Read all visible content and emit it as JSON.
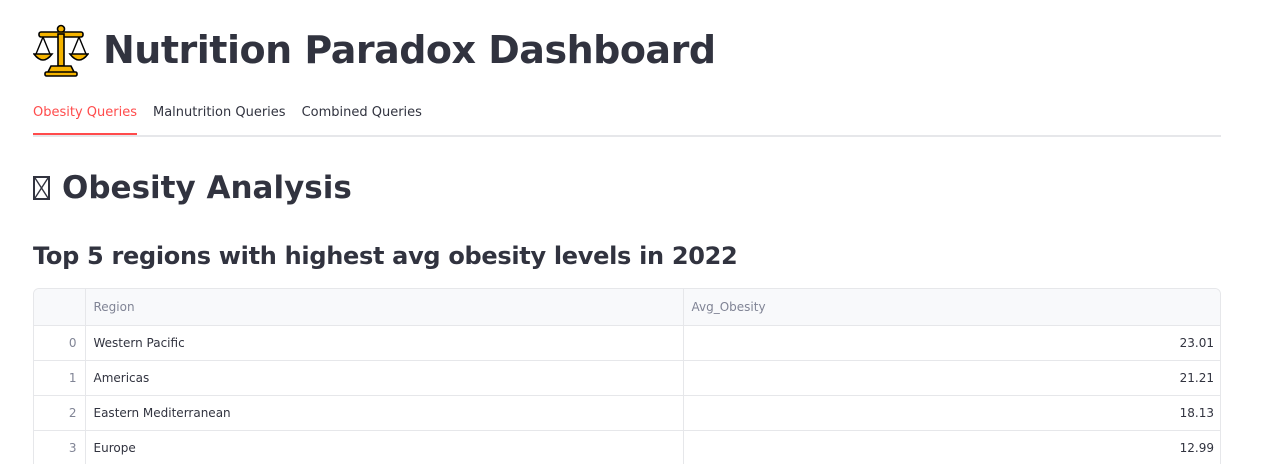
{
  "app": {
    "title": "Nutrition Paradox Dashboard",
    "title_icon": "balance-scale-icon"
  },
  "tabs": [
    {
      "label": "Obesity Queries",
      "active": true
    },
    {
      "label": "Malnutrition Queries",
      "active": false
    },
    {
      "label": "Combined Queries",
      "active": false
    }
  ],
  "section": {
    "heading": "Obesity Analysis",
    "icon": "missing-glyph-icon"
  },
  "query": {
    "title": "Top 5 regions with highest avg obesity levels in 2022"
  },
  "table": {
    "columns": [
      "",
      "Region",
      "Avg_Obesity"
    ],
    "rows": [
      {
        "index": "0",
        "region": "Western Pacific",
        "avg_obesity": "23.01"
      },
      {
        "index": "1",
        "region": "Americas",
        "avg_obesity": "21.21"
      },
      {
        "index": "2",
        "region": "Eastern Mediterranean",
        "avg_obesity": "18.13"
      },
      {
        "index": "3",
        "region": "Europe",
        "avg_obesity": "12.99"
      }
    ]
  },
  "colors": {
    "accent": "#ff4b4b",
    "text": "#31333f",
    "muted": "#808495",
    "border": "#e6e7ea",
    "header_bg": "#f8f9fb"
  }
}
